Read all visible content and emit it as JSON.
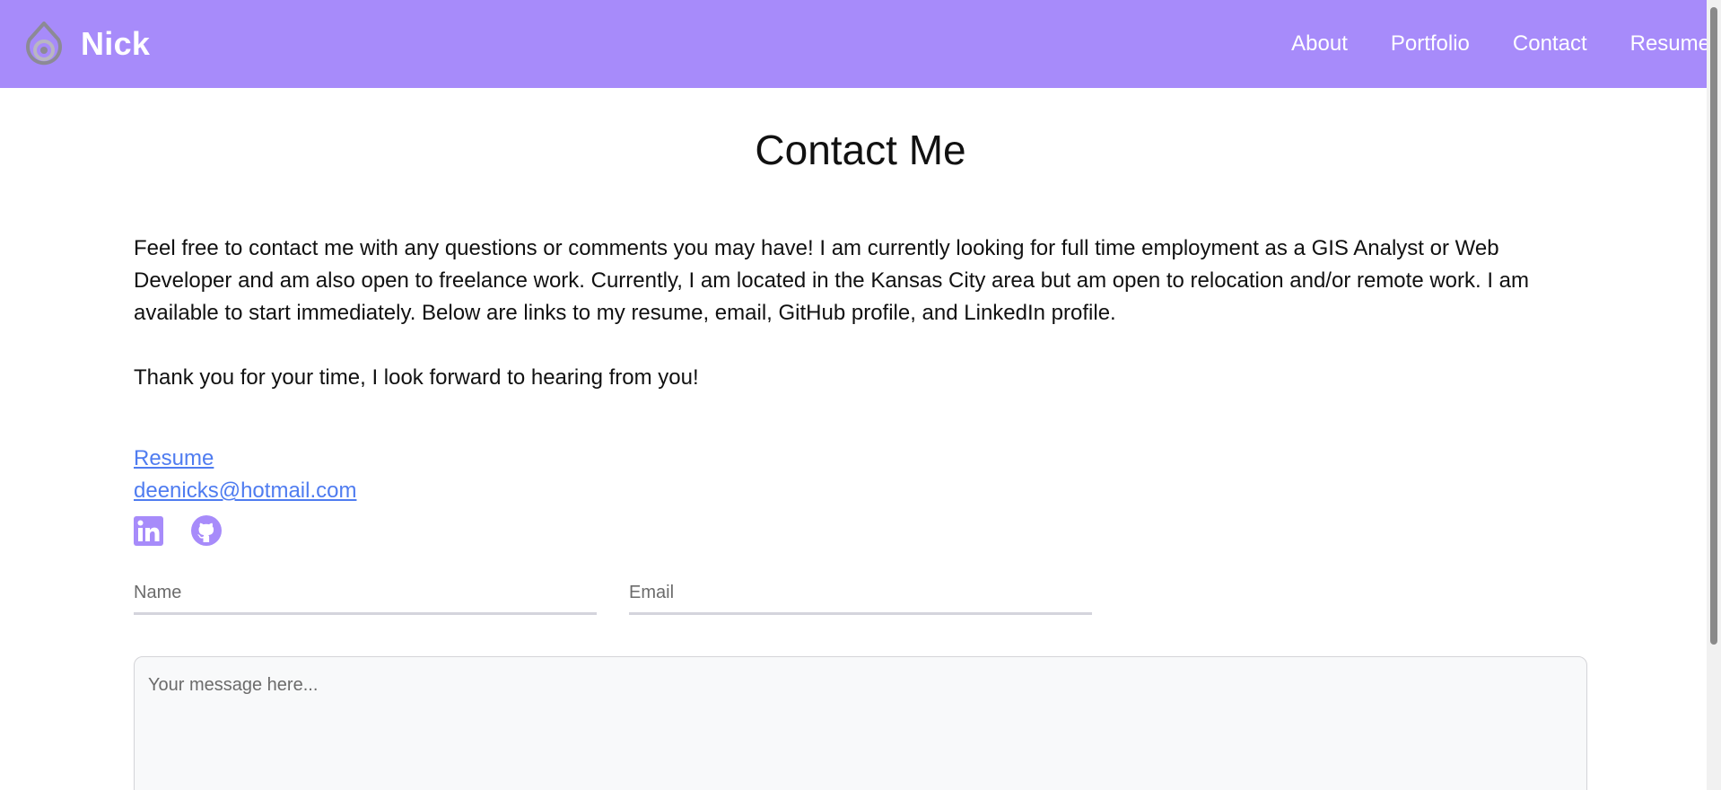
{
  "navbar": {
    "brand_name": "Nick",
    "logo_icon": "droplet-logo-icon",
    "links": [
      {
        "label": "About"
      },
      {
        "label": "Portfolio"
      },
      {
        "label": "Contact"
      },
      {
        "label": "Resume"
      }
    ],
    "background_color": "#a78bfa"
  },
  "main": {
    "title": "Contact Me",
    "intro": "Feel free to contact me with any questions or comments you may have! I am currently looking for full time employment as a GIS Analyst or Web Developer and am also open to freelance work. Currently, I am located in the Kansas City area but am open to relocation and/or remote work. I am available to start immediately. Below are links to my resume, email, GitHub profile, and LinkedIn profile.",
    "thanks": "Thank you for your time, I look forward to hearing from you!",
    "links": {
      "resume": "Resume",
      "email": "deenicks@hotmail.com"
    },
    "social": [
      {
        "icon": "linkedin-icon"
      },
      {
        "icon": "github-icon"
      }
    ],
    "link_color": "#4f7cf0",
    "icon_color": "#a78bfa"
  },
  "form": {
    "name_placeholder": "Name",
    "email_placeholder": "Email",
    "message_placeholder": "Your message here..."
  }
}
